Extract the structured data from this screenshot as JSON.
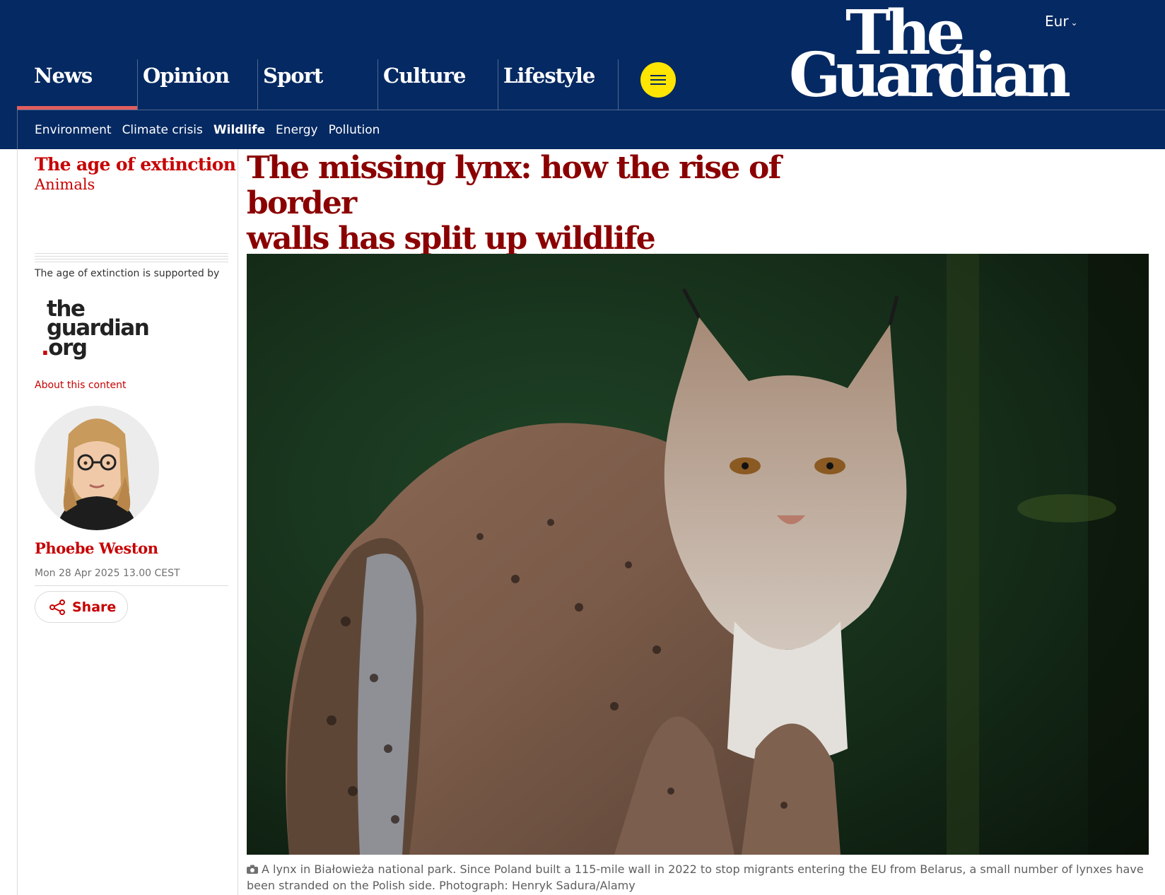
{
  "header": {
    "edition": "Eur",
    "logo_line1": "The",
    "logo_line2": "Guardian",
    "pillars": [
      {
        "label": "News",
        "active": true
      },
      {
        "label": "Opinion",
        "active": false
      },
      {
        "label": "Sport",
        "active": false
      },
      {
        "label": "Culture",
        "active": false
      },
      {
        "label": "Lifestyle",
        "active": false
      }
    ],
    "subnav": [
      {
        "label": "Environment",
        "active": false
      },
      {
        "label": "Climate crisis",
        "active": false
      },
      {
        "label": "Wildlife",
        "active": true
      },
      {
        "label": "Energy",
        "active": false
      },
      {
        "label": "Pollution",
        "active": false
      }
    ]
  },
  "sidebar": {
    "series_title": "The age of extinction",
    "series_subtitle": "Animals",
    "sponsor_label": "The age of extinction is supported by",
    "sponsor_logo": {
      "line1": "the",
      "line2": "guardian",
      "line3": ".org"
    },
    "about_link": "About this content",
    "author": "Phoebe Weston",
    "date": "Mon 28 Apr 2025 13.00 CEST",
    "share_label": "Share"
  },
  "article": {
    "headline_line1": "The missing lynx: how the rise of border",
    "headline_line2": "walls has split up wildlife populations",
    "caption": "A lynx in Białowieża national park. Since Poland built a 115-mile wall in 2022 to stop migrants entering the EU from Belarus, a small number of lynxes have been stranded on the Polish side. Photograph: Henryk Sadura/Alamy"
  },
  "colors": {
    "brand_blue": "#052962",
    "news_red": "#c70000",
    "headline_red": "#8b0000",
    "menu_yellow": "#ffe500",
    "active_underline": "#e05e5e"
  },
  "icons": {
    "menu": "hamburger-icon",
    "share": "share-icon",
    "caption": "camera-icon",
    "edition": "chevron-down-icon"
  }
}
